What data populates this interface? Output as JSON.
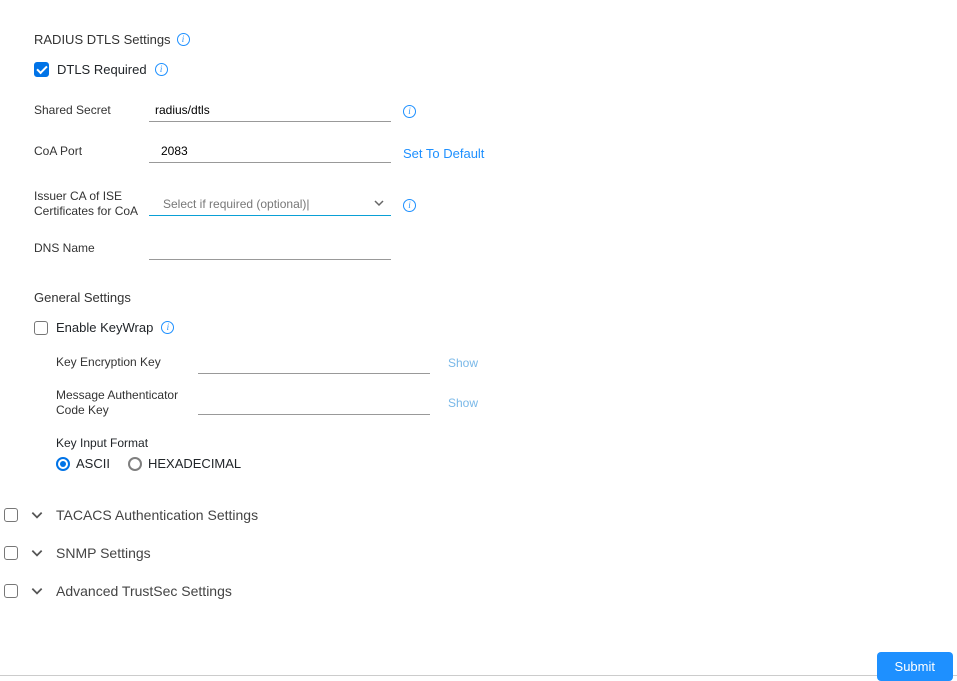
{
  "radiusDtls": {
    "title": "RADIUS DTLS Settings",
    "dtlsRequired": {
      "label": "DTLS Required",
      "checked": true
    },
    "sharedSecret": {
      "label": "Shared Secret",
      "value": "radius/dtls"
    },
    "coaPort": {
      "label": "CoA Port",
      "value": "2083",
      "setToDefault": "Set To Default"
    },
    "issuerCa": {
      "label": "Issuer CA of ISE Certificates for CoA",
      "placeholder": "Select if required (optional)|",
      "value": ""
    },
    "dnsName": {
      "label": "DNS Name",
      "value": ""
    }
  },
  "generalSettings": {
    "title": "General Settings",
    "enableKeyWrap": {
      "label": "Enable KeyWrap",
      "checked": false
    },
    "keyEncryptionKey": {
      "label": "Key Encryption Key",
      "value": "",
      "showLabel": "Show"
    },
    "macKey": {
      "label": "Message Authenticator Code Key",
      "value": "",
      "showLabel": "Show"
    },
    "keyInputFormat": {
      "label": "Key Input Format",
      "options": [
        {
          "id": "ascii",
          "label": "ASCII",
          "selected": true
        },
        {
          "id": "hex",
          "label": "HEXADECIMAL",
          "selected": false
        }
      ]
    }
  },
  "collapsibleSections": [
    {
      "id": "tacacs",
      "label": "TACACS Authentication Settings",
      "checked": false
    },
    {
      "id": "snmp",
      "label": "SNMP Settings",
      "checked": false
    },
    {
      "id": "trustsec",
      "label": "Advanced TrustSec Settings",
      "checked": false
    }
  ],
  "footer": {
    "submit": "Submit"
  }
}
